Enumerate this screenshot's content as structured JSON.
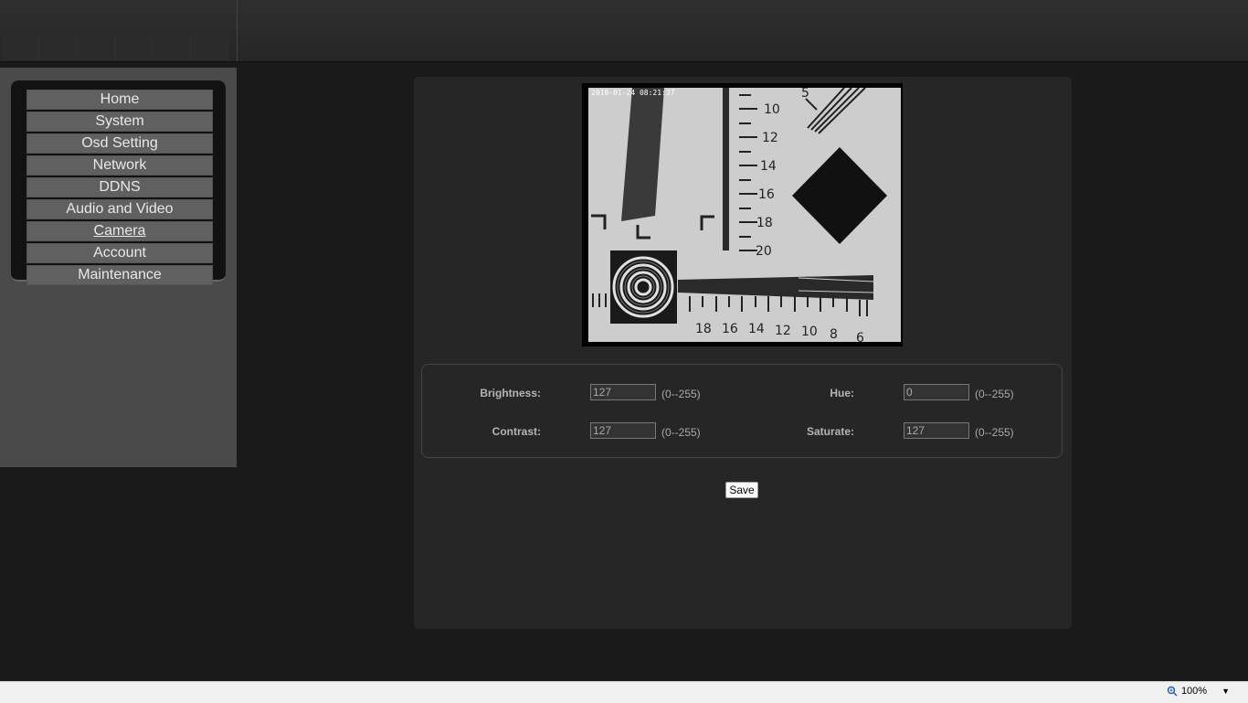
{
  "menu": {
    "items": [
      {
        "label": "Home"
      },
      {
        "label": "System"
      },
      {
        "label": "Osd Setting"
      },
      {
        "label": "Network"
      },
      {
        "label": "DDNS"
      },
      {
        "label": "Audio and Video"
      },
      {
        "label": "Camera",
        "active": true
      },
      {
        "label": "Account"
      },
      {
        "label": "Maintenance"
      }
    ]
  },
  "preview": {
    "timestamp": "2018-01-24 08:21:37",
    "scale_labels_vertical": [
      "10",
      "12",
      "14",
      "16",
      "18",
      "20"
    ],
    "scale_labels_horizontal": [
      "18",
      "16",
      "14",
      "12",
      "10",
      "8",
      "6"
    ],
    "scale_label_top": "5"
  },
  "settings": {
    "brightness": {
      "label": "Brightness:",
      "value": "127",
      "range": "(0--255)"
    },
    "contrast": {
      "label": "Contrast:",
      "value": "127",
      "range": "(0--255)"
    },
    "hue": {
      "label": "Hue:",
      "value": "0",
      "range": "(0--255)"
    },
    "saturate": {
      "label": "Saturate:",
      "value": "127",
      "range": "(0--255)"
    }
  },
  "save_label": "Save",
  "statusbar": {
    "zoom": "100%"
  }
}
